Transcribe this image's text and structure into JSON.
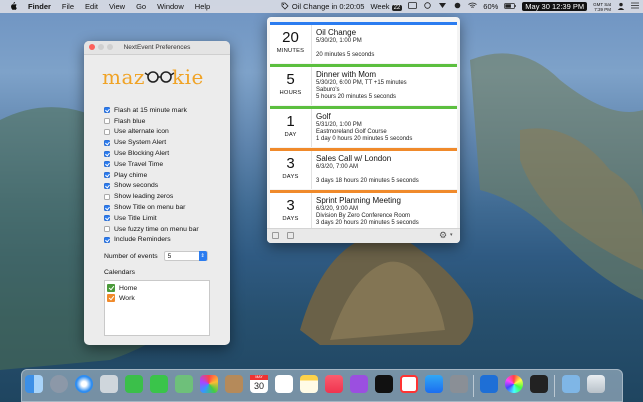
{
  "menubar": {
    "apple": "",
    "app_name": "Finder",
    "menus": [
      "File",
      "Edit",
      "View",
      "Go",
      "Window",
      "Help"
    ],
    "event_status": "Oil Change in 0:20:05",
    "week_label": "Week",
    "week_number": "22",
    "battery": "60%",
    "clock": "May 30  12:39 PM",
    "gmt_label": "GMT Sat",
    "gmt_time": "7:39 PM"
  },
  "prefs": {
    "window_title": "NextEvent Preferences",
    "logo": "mazookie",
    "options": [
      {
        "label": "Flash at 15 minute mark",
        "checked": true
      },
      {
        "label": "Flash blue",
        "checked": false
      },
      {
        "label": "Use alternate icon",
        "checked": false
      },
      {
        "label": "Use System Alert",
        "checked": true
      },
      {
        "label": "Use Blocking Alert",
        "checked": true
      },
      {
        "label": "Use Travel Time",
        "checked": true
      },
      {
        "label": "Play chime",
        "checked": true
      },
      {
        "label": "Show seconds",
        "checked": true
      },
      {
        "label": "Show leading zeros",
        "checked": false
      },
      {
        "label": "Show Title on menu bar",
        "checked": true
      },
      {
        "label": "Use Title Limit",
        "checked": true
      },
      {
        "label": "Use fuzzy time on menu bar",
        "checked": false
      },
      {
        "label": "Include Reminders",
        "checked": true
      }
    ],
    "events_label": "Number of events",
    "events_value": "5",
    "calendars_label": "Calendars",
    "calendars": [
      {
        "label": "Home",
        "color": "#4a9a3a"
      },
      {
        "label": "Work",
        "color": "#f08a2b"
      }
    ]
  },
  "events": [
    {
      "num": "20",
      "unit": "MINUTES",
      "title": "Oil Change",
      "lines": [
        "5/30/20, 1:00 PM",
        "",
        "20 minutes 5 seconds"
      ],
      "color": "#2b7cf0"
    },
    {
      "num": "5",
      "unit": "HOURS",
      "title": "Dinner with Mom",
      "lines": [
        "5/30/20, 6:00 PM, TT +15 minutes",
        "Saburo's",
        "5 hours 20 minutes 5 seconds"
      ],
      "color": "#5cbf3f"
    },
    {
      "num": "1",
      "unit": "DAY",
      "title": "Golf",
      "lines": [
        "5/31/20, 1:00 PM",
        "Eastmoreland Golf Course",
        "1 day 0 hours 20 minutes 5 seconds"
      ],
      "color": "#5cbf3f"
    },
    {
      "num": "3",
      "unit": "DAYS",
      "title": "Sales Call w/ London",
      "lines": [
        "6/3/20, 7:00 AM",
        "",
        "3 days 18 hours 20 minutes 5 seconds"
      ],
      "color": "#f08a2b"
    },
    {
      "num": "3",
      "unit": "DAYS",
      "title": "Sprint Planning Meeting",
      "lines": [
        "6/3/20, 9:00 AM",
        "Division By Zero Conference Room",
        "3 days 20 hours 20 minutes 5 seconds"
      ],
      "color": "#f08a2b"
    }
  ],
  "colors": {
    "accent": "#2b7cf0",
    "logo": "#f0a326"
  },
  "dock": {
    "calendar_day": "30",
    "icons": [
      "finder-icon",
      "launchpad-icon",
      "safari-icon",
      "mail-stamp-icon",
      "facetime-icon",
      "messages-icon",
      "maps-icon",
      "photos-icon",
      "contacts-icon",
      "calendar-icon",
      "reminders-icon",
      "notes-icon",
      "music-icon",
      "podcasts-icon",
      "apple-tv-icon",
      "news-icon",
      "app-store-icon",
      "system-preferences-icon",
      "xcode-icon",
      "color-picker-icon",
      "terminal-icon",
      "downloads-folder-icon",
      "trash-icon"
    ]
  }
}
